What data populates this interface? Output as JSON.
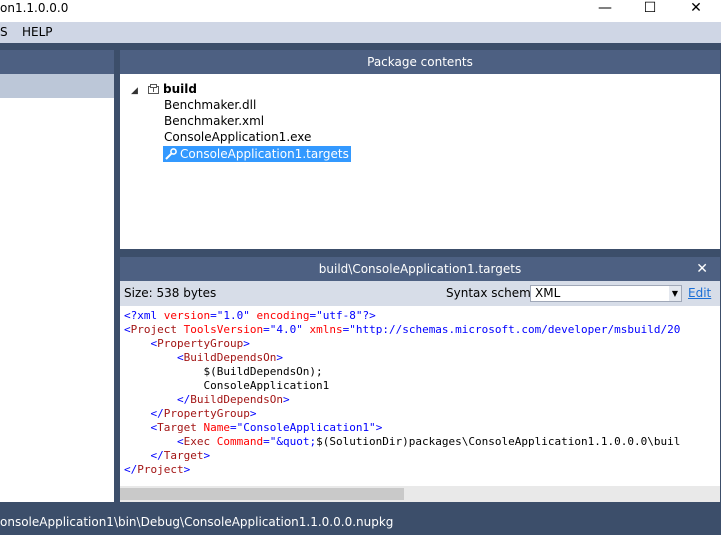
{
  "window": {
    "title": "on1.1.0.0.0",
    "minimize_glyph": "—",
    "maximize_glyph": "☐",
    "close_glyph": "✕"
  },
  "menu": {
    "items": [
      {
        "label": "S"
      },
      {
        "label": "HELP"
      }
    ]
  },
  "package_contents": {
    "header": "Package contents",
    "folder": {
      "label": "build",
      "expander_glyph": "◢"
    },
    "files": [
      {
        "label": "Benchmaker.dll"
      },
      {
        "label": "Benchmaker.xml"
      },
      {
        "label": "ConsoleApplication1.exe"
      },
      {
        "label": "ConsoleApplication1.targets",
        "selected": true,
        "icon": "wrench-icon"
      }
    ]
  },
  "file_view": {
    "header": "build\\ConsoleApplication1.targets",
    "close_glyph": "✕",
    "size_text": "Size: 538 bytes",
    "syntax_label": "Syntax scheme:",
    "syntax_value": "XML",
    "syntax_arrow": "▼",
    "edit_label": "Edit"
  },
  "code_lines": [
    [
      [
        "t-punct",
        "<?xml "
      ],
      [
        "t-attr",
        "version"
      ],
      [
        "t-punct",
        "="
      ],
      [
        "t-val",
        "\"1.0\""
      ],
      [
        "t-punct",
        " "
      ],
      [
        "t-attr",
        "encoding"
      ],
      [
        "t-punct",
        "="
      ],
      [
        "t-val",
        "\"utf-8\""
      ],
      [
        "t-punct",
        "?>"
      ]
    ],
    [
      [
        "t-punct",
        "<"
      ],
      [
        "t-tag",
        "Project "
      ],
      [
        "t-attr",
        "ToolsVersion"
      ],
      [
        "t-punct",
        "="
      ],
      [
        "t-val",
        "\"4.0\""
      ],
      [
        "t-punct",
        " "
      ],
      [
        "t-attr",
        "xmlns"
      ],
      [
        "t-punct",
        "="
      ],
      [
        "t-val",
        "\"http://schemas.microsoft.com/developer/msbuild/20"
      ]
    ],
    [
      [
        "t-punct",
        "    <"
      ],
      [
        "t-tag",
        "PropertyGroup"
      ],
      [
        "t-punct",
        ">"
      ]
    ],
    [
      [
        "t-punct",
        "        <"
      ],
      [
        "t-tag",
        "BuildDependsOn"
      ],
      [
        "t-punct",
        ">"
      ]
    ],
    [
      [
        "plain",
        "            $(BuildDependsOn);"
      ]
    ],
    [
      [
        "plain",
        "            ConsoleApplication1"
      ]
    ],
    [
      [
        "t-punct",
        "        </"
      ],
      [
        "t-tag",
        "BuildDependsOn"
      ],
      [
        "t-punct",
        ">"
      ]
    ],
    [
      [
        "t-punct",
        "    </"
      ],
      [
        "t-tag",
        "PropertyGroup"
      ],
      [
        "t-punct",
        ">"
      ]
    ],
    [
      [
        "t-punct",
        "    <"
      ],
      [
        "t-tag",
        "Target "
      ],
      [
        "t-attr",
        "Name"
      ],
      [
        "t-punct",
        "="
      ],
      [
        "t-val",
        "\"ConsoleApplication1\""
      ],
      [
        "t-punct",
        ">"
      ]
    ],
    [
      [
        "t-punct",
        "        <"
      ],
      [
        "t-tag",
        "Exec "
      ],
      [
        "t-attr",
        "Command"
      ],
      [
        "t-punct",
        "="
      ],
      [
        "t-val",
        "\"&quot;"
      ],
      [
        "plain",
        "$(SolutionDir)packages\\ConsoleApplication1.1.0.0.0\\buil"
      ]
    ],
    [
      [
        "t-punct",
        "    </"
      ],
      [
        "t-tag",
        "Target"
      ],
      [
        "t-punct",
        ">"
      ]
    ],
    [
      [
        "t-punct",
        "</"
      ],
      [
        "t-tag",
        "Project"
      ],
      [
        "t-punct",
        ">"
      ]
    ]
  ],
  "status": {
    "path": "onsoleApplication1\\bin\\Debug\\ConsoleApplication1.1.0.0.0.nupkg"
  },
  "colors": {
    "chrome": "#3c4e6a",
    "panel_header": "#4d6082",
    "selection": "#3399ff",
    "link": "#1a6fd6"
  }
}
